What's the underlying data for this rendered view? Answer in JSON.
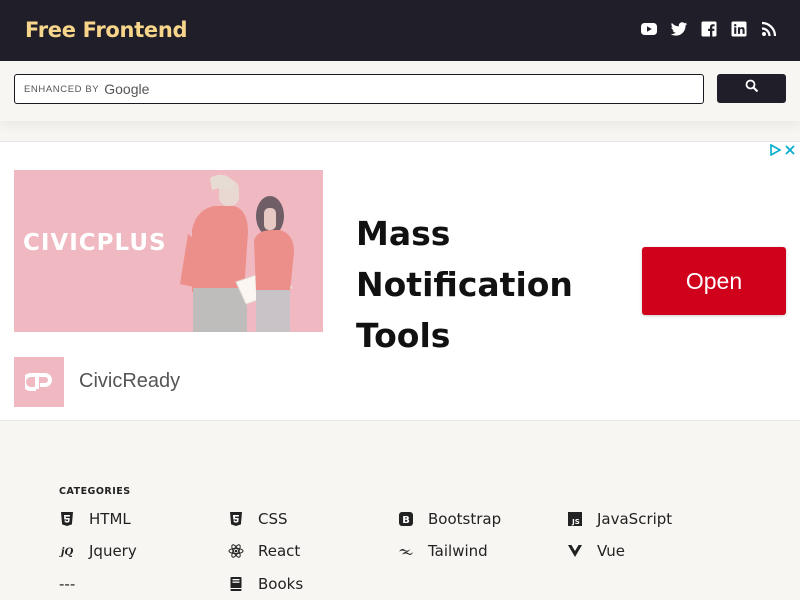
{
  "header": {
    "brand": "Free Frontend",
    "social_icons": [
      "youtube-icon",
      "twitter-icon",
      "facebook-icon",
      "linkedin-icon",
      "rss-icon"
    ]
  },
  "search": {
    "enhanced_label": "ENHANCED BY",
    "google_label": "Google",
    "button_icon": "search-icon"
  },
  "ad": {
    "image_logo": "CIVICPLUS",
    "headline_lines": [
      "Mass",
      "Notification",
      "Tools"
    ],
    "cta_label": "Open",
    "advertiser": "CivicReady",
    "cta_color": "#d0021b",
    "image_color": "#f0b8c1"
  },
  "categories": {
    "title": "CATEGORIES",
    "items": [
      {
        "label": "HTML",
        "icon": "html5-icon"
      },
      {
        "label": "CSS",
        "icon": "css3-icon"
      },
      {
        "label": "Bootstrap",
        "icon": "bootstrap-icon"
      },
      {
        "label": "JavaScript",
        "icon": "js-icon"
      },
      {
        "label": "Jquery",
        "icon": "jquery-icon"
      },
      {
        "label": "React",
        "icon": "react-icon"
      },
      {
        "label": "Tailwind",
        "icon": "tailwind-icon"
      },
      {
        "label": "Vue",
        "icon": "vue-icon"
      },
      {
        "label": "---",
        "icon": ""
      },
      {
        "label": "Books",
        "icon": "book-icon"
      }
    ]
  },
  "colors": {
    "header_bg": "#201f29",
    "brand": "#f7d58a",
    "page_bg": "#f7f6f3"
  }
}
